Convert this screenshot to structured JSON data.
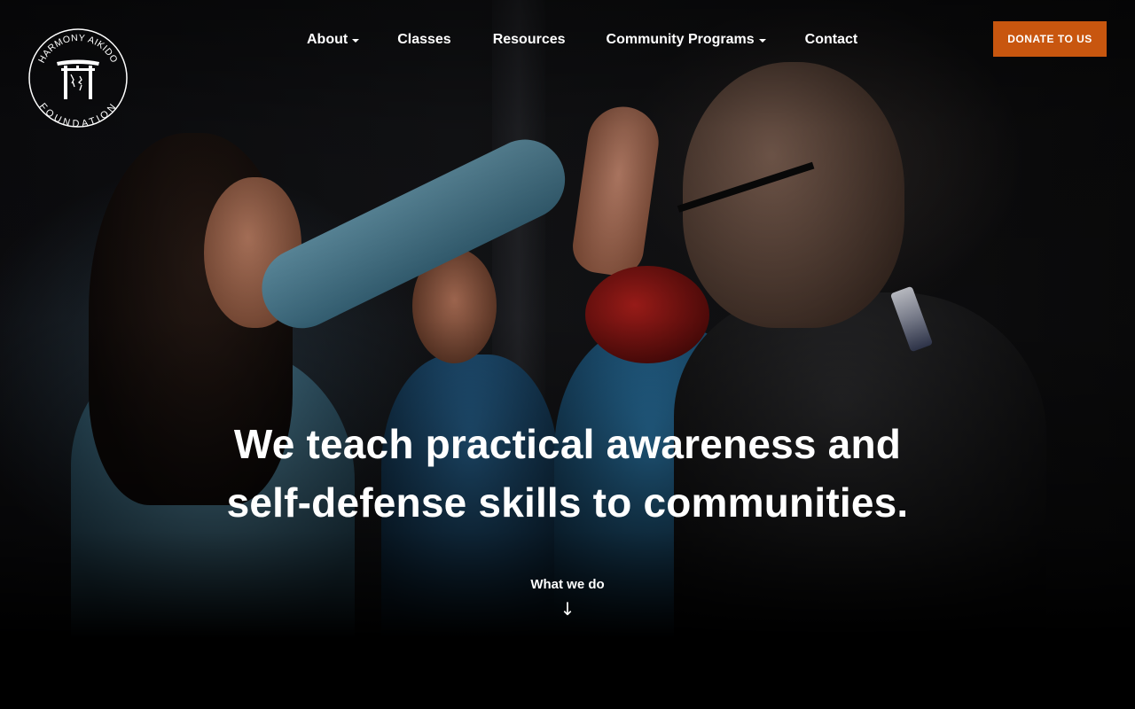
{
  "logo": {
    "text_top": "HARMONY AIKIDO",
    "text_bottom": "FOUNDATION",
    "icon": "torii-gate-icon"
  },
  "nav": {
    "items": [
      {
        "label": "About",
        "has_dropdown": true
      },
      {
        "label": "Classes",
        "has_dropdown": false
      },
      {
        "label": "Resources",
        "has_dropdown": false
      },
      {
        "label": "Community Programs",
        "has_dropdown": true
      },
      {
        "label": "Contact",
        "has_dropdown": false
      }
    ]
  },
  "donate": {
    "label": "DONATE TO US",
    "color": "#c8560f"
  },
  "hero": {
    "headline_line1": "We teach practical awareness and",
    "headline_line2": "self-defense skills to communities.",
    "cta_label": "What we do",
    "cta_icon": "arrow-down-icon"
  }
}
